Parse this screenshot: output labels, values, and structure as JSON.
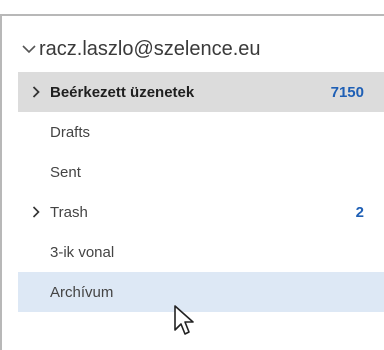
{
  "account": {
    "email": "racz.laszlo@szelence.eu",
    "expand_icon": "chevron-down-icon"
  },
  "folders": [
    {
      "label": "Beérkezett üzenetek",
      "count": "7150",
      "expandable": true,
      "selected": true
    },
    {
      "label": "Drafts",
      "count": "",
      "expandable": false
    },
    {
      "label": "Sent",
      "count": "",
      "expandable": false
    },
    {
      "label": "Trash",
      "count": "2",
      "expandable": true
    },
    {
      "label": "3-ik vonal",
      "count": "",
      "expandable": false
    },
    {
      "label": "Archívum",
      "count": "",
      "expandable": false,
      "hovered": true
    }
  ],
  "colors": {
    "selected_bg": "#dcdcdc",
    "hover_bg": "#dde8f5",
    "count_blue": "#1e5fb5"
  },
  "cursor": "mouse-pointer-icon"
}
